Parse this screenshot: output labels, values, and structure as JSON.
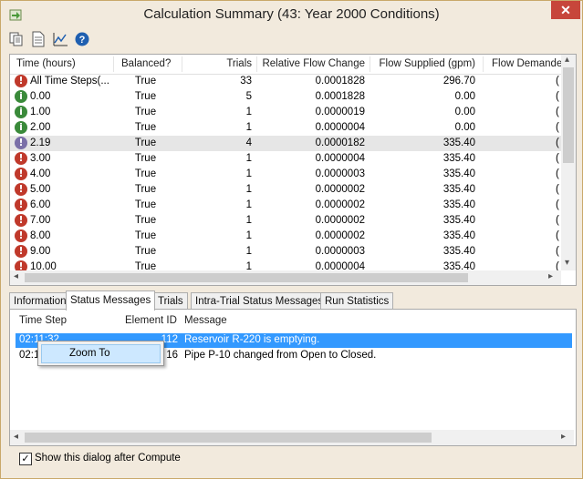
{
  "window": {
    "title": "Calculation Summary (43: Year 2000 Conditions)",
    "close_label": "✕"
  },
  "toolbar": {
    "icons": [
      "copy-icon",
      "report-icon",
      "graph-icon",
      "help-icon"
    ]
  },
  "grid": {
    "columns": [
      "Time (hours)",
      "Balanced?",
      "Trials",
      "Relative Flow Change",
      "Flow Supplied (gpm)",
      "Flow Demanded"
    ],
    "rows": [
      {
        "status": "error",
        "time": "All Time Steps(...",
        "balanced": "True",
        "trials": "33",
        "rel_change": "0.0001828",
        "supplied": "296.70",
        "demanded": "("
      },
      {
        "status": "info",
        "time": "0.00",
        "balanced": "True",
        "trials": "5",
        "rel_change": "0.0001828",
        "supplied": "0.00",
        "demanded": "("
      },
      {
        "status": "info",
        "time": "1.00",
        "balanced": "True",
        "trials": "1",
        "rel_change": "0.0000019",
        "supplied": "0.00",
        "demanded": "("
      },
      {
        "status": "info",
        "time": "2.00",
        "balanced": "True",
        "trials": "1",
        "rel_change": "0.0000004",
        "supplied": "0.00",
        "demanded": "("
      },
      {
        "status": "warning",
        "time": "2.19",
        "balanced": "True",
        "trials": "4",
        "rel_change": "0.0000182",
        "supplied": "335.40",
        "demanded": "("
      },
      {
        "status": "error",
        "time": "3.00",
        "balanced": "True",
        "trials": "1",
        "rel_change": "0.0000004",
        "supplied": "335.40",
        "demanded": "("
      },
      {
        "status": "error",
        "time": "4.00",
        "balanced": "True",
        "trials": "1",
        "rel_change": "0.0000003",
        "supplied": "335.40",
        "demanded": "("
      },
      {
        "status": "error",
        "time": "5.00",
        "balanced": "True",
        "trials": "1",
        "rel_change": "0.0000002",
        "supplied": "335.40",
        "demanded": "("
      },
      {
        "status": "error",
        "time": "6.00",
        "balanced": "True",
        "trials": "1",
        "rel_change": "0.0000002",
        "supplied": "335.40",
        "demanded": "("
      },
      {
        "status": "error",
        "time": "7.00",
        "balanced": "True",
        "trials": "1",
        "rel_change": "0.0000002",
        "supplied": "335.40",
        "demanded": "("
      },
      {
        "status": "error",
        "time": "8.00",
        "balanced": "True",
        "trials": "1",
        "rel_change": "0.0000002",
        "supplied": "335.40",
        "demanded": "("
      },
      {
        "status": "error",
        "time": "9.00",
        "balanced": "True",
        "trials": "1",
        "rel_change": "0.0000003",
        "supplied": "335.40",
        "demanded": "("
      },
      {
        "status": "error",
        "time": "10.00",
        "balanced": "True",
        "trials": "1",
        "rel_change": "0.0000004",
        "supplied": "335.40",
        "demanded": "("
      }
    ],
    "selected_row": 4
  },
  "tabs": [
    "Information",
    "Status Messages",
    "Trials",
    "Intra-Trial Status Messages",
    "Run Statistics"
  ],
  "active_tab": 1,
  "messages": {
    "columns": [
      "Time Step",
      "Element ID",
      "Message"
    ],
    "rows": [
      {
        "time_step": "02:11:32",
        "element_id": "112",
        "message": "Reservoir R-220 is emptying."
      },
      {
        "time_step": "02:11:32",
        "element_id": "16",
        "message": "Pipe P-10 changed from Open to Closed."
      }
    ]
  },
  "context_menu": {
    "item": "Zoom To"
  },
  "footer": {
    "checkbox_label": "Show this dialog after Compute",
    "checked": true
  },
  "colors": {
    "error": "#c0392b",
    "info": "#3a8a3a",
    "warning": "#7a6fa8",
    "help": "#1f5fb0",
    "selection": "#3399ff"
  }
}
